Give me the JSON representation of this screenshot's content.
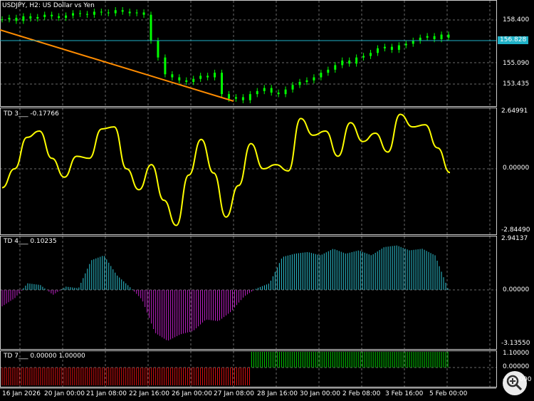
{
  "symbol_title": "USDJPY, H2:  US Dollar vs Yen",
  "current_price": "156.828",
  "price_axis": [
    "158.400",
    "156.828",
    "155.090",
    "153.435"
  ],
  "panels": [
    {
      "title": "TD 3___ -0.17766",
      "ticks": [
        "2.64991",
        "0.00000",
        "-2.84490"
      ]
    },
    {
      "title": "TD 4___ 0.10235",
      "ticks": [
        "2.94137",
        "0.00000",
        "-3.13550"
      ]
    },
    {
      "title": "TD 7___ 0.00000 1.00000",
      "ticks": [
        "1.10000",
        "0.00000",
        "-0.10000"
      ]
    }
  ],
  "time_axis": [
    "16 Jan 2026",
    "20 Jan 00:00",
    "21 Jan 08:00",
    "22 Jan 16:00",
    "26 Jan 00:00",
    "27 Jan 08:00",
    "28 Jan 16:00",
    "30 Jan 00:00",
    "2 Feb 08:00",
    "3 Feb 16:00",
    "5 Feb 00:00"
  ],
  "colors": {
    "candle": "#00ff00",
    "trendline": "#ff8c00",
    "td3": "#ffff00",
    "td4_pos": "#2fc8d8",
    "td4_neg": "#c020c8",
    "td7_pos": "#00d000",
    "td7_neg": "#e01010",
    "grid": "#6a6a6a",
    "price_line": "#20b2c8"
  },
  "zoom_icon": "zoom-magnifier-icon",
  "chart_data": {
    "type": "line",
    "price_series": [
      158.1,
      158.2,
      158.0,
      158.3,
      158.15,
      158.25,
      158.4,
      158.3,
      158.2,
      158.35,
      158.5,
      158.45,
      158.4,
      158.6,
      158.55,
      158.5,
      158.7,
      158.6,
      158.5,
      158.55,
      158.4,
      156.7,
      155.6,
      154.5,
      154.3,
      154.1,
      154.0,
      154.2,
      154.4,
      154.3,
      154.6,
      153.2,
      152.9,
      153.0,
      152.8,
      153.2,
      153.4,
      153.6,
      153.3,
      153.2,
      153.5,
      153.8,
      154.0,
      154.1,
      154.3,
      154.6,
      154.8,
      155.1,
      155.4,
      155.2,
      155.6,
      155.7,
      155.9,
      156.2,
      156.3,
      156.1,
      156.4,
      156.5,
      156.7,
      156.9,
      157.0,
      156.8,
      157.1,
      156.9
    ],
    "td3_series": [
      -0.9,
      0.0,
      1.5,
      1.8,
      0.5,
      -0.4,
      0.6,
      0.5,
      1.9,
      2.0,
      0.0,
      -1.0,
      0.2,
      -1.5,
      -2.7,
      -0.3,
      1.4,
      -0.2,
      -2.3,
      -0.8,
      1.2,
      0.0,
      0.2,
      -0.1,
      2.4,
      1.6,
      1.8,
      0.6,
      2.2,
      1.3,
      1.7,
      0.8,
      2.6,
      2.0,
      2.1,
      1.0,
      -0.18
    ],
    "td4_series": [
      -1.0,
      -0.5,
      0.4,
      0.3,
      -0.3,
      0.2,
      0.1,
      1.8,
      2.1,
      0.9,
      0.2,
      -0.6,
      -2.6,
      -3.1,
      -2.7,
      -2.5,
      -1.8,
      -1.9,
      -1.3,
      -0.4,
      0.1,
      0.4,
      2.0,
      2.2,
      2.3,
      2.1,
      2.5,
      2.2,
      2.4,
      2.1,
      2.6,
      2.7,
      2.4,
      2.5,
      2.1,
      0.1
    ],
    "td7_series": [
      0,
      0,
      0,
      0,
      0,
      0,
      0,
      0,
      0,
      0,
      0,
      0,
      0,
      0,
      0,
      0,
      0,
      0,
      0,
      0,
      1,
      1,
      1,
      1,
      1,
      1,
      1,
      1,
      1,
      1,
      1,
      1,
      1,
      1,
      1,
      1
    ]
  }
}
